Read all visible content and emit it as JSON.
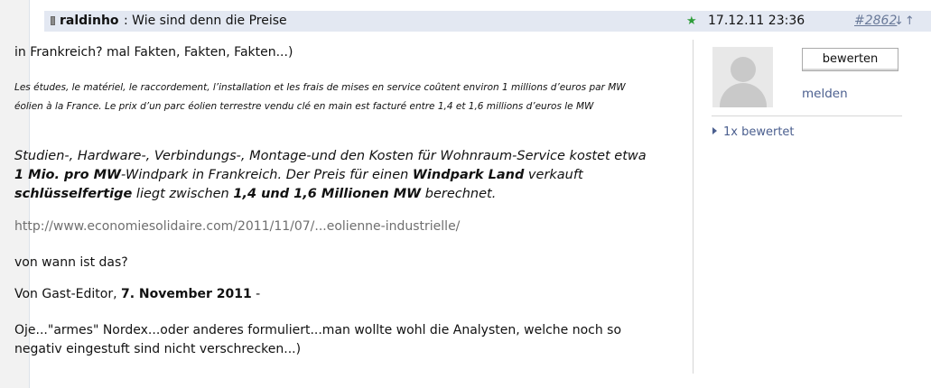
{
  "header": {
    "username": "raldinho",
    "title": ": Wie sind denn die Preise",
    "date": "17.12.11 23:36",
    "post_number": "#2862",
    "sort_arrows": "↓↑"
  },
  "body": {
    "intro": "in Frankreich? mal Fakten, Fakten, Fakten...)",
    "quote": "Les études, le matériel, le raccordement, l’installation et les frais de mises en service coûtent environ 1 millions d’euros par MW éolien à la France. Le prix d’un parc éolien terrestre vendu clé en main est facturé entre 1,4 et 1,6 millions d’euros le MW",
    "translation": {
      "t1": "Studien-, Hardware-, Verbindungs-, Montage-und den Kosten für Wohnraum-Service kostet etwa ",
      "b1": "1 Mio. pro MW",
      "t2": "-Windpark in Frankreich. Der Preis für einen ",
      "b2": "Windpark Land",
      "t3": " verkauft ",
      "b3": "schlüsselfertige",
      "t4": " liegt zwischen ",
      "b4": "1,4 und 1,6 Millionen MW",
      "t5": " berechnet."
    },
    "link": "http://www.economiesolidaire.com/2011/11/07/...eolienne-industrielle/",
    "question": "von wann ist das?",
    "source_prefix": "Von Gast-Editor, ",
    "source_date": "7. November 2011",
    "source_suffix": " -",
    "comment": "Oje...\"armes\" Nordex...oder anderes formuliert...man wollte wohl die Analysten, welche noch so negativ eingestuft sind nicht verschrecken...)"
  },
  "sidebar": {
    "rate_button": "bewerten",
    "report_link": "melden",
    "rated_count": "1x bewertet"
  },
  "colors": {
    "header_bg": "#e3e8f2",
    "link_color": "#4b5f8f",
    "star_color": "#2e9d3a"
  }
}
